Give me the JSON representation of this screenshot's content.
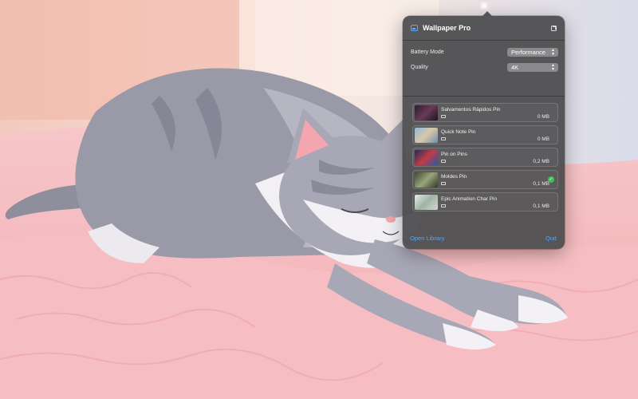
{
  "menubar": {
    "icon": "wallpaper-status-icon"
  },
  "popover": {
    "title": "Wallpaper Pro",
    "app_icon": "wallpaper-app-icon",
    "settings": [
      {
        "label": "Battery Mode",
        "value": "Performance"
      },
      {
        "label": "Quality",
        "value": "4K"
      }
    ],
    "wallpapers": [
      {
        "name": "Salvamentos Rápidos Pin",
        "size": "0 MB",
        "active": false
      },
      {
        "name": "Quick Note Pin",
        "size": "0 MB",
        "active": false
      },
      {
        "name": "Pin on Pins",
        "size": "0,2 MB",
        "active": false
      },
      {
        "name": "Moldes Pin",
        "size": "0,1 MB",
        "active": true
      },
      {
        "name": "Epic Animation Char Pin",
        "size": "0,1 MB",
        "active": false
      }
    ],
    "footer": {
      "open_library": "Open Library",
      "quit": "Quit"
    }
  },
  "colors": {
    "accent": "#4ea8ff",
    "active_check": "#3fbf5a",
    "panel": "#4e4e50"
  }
}
